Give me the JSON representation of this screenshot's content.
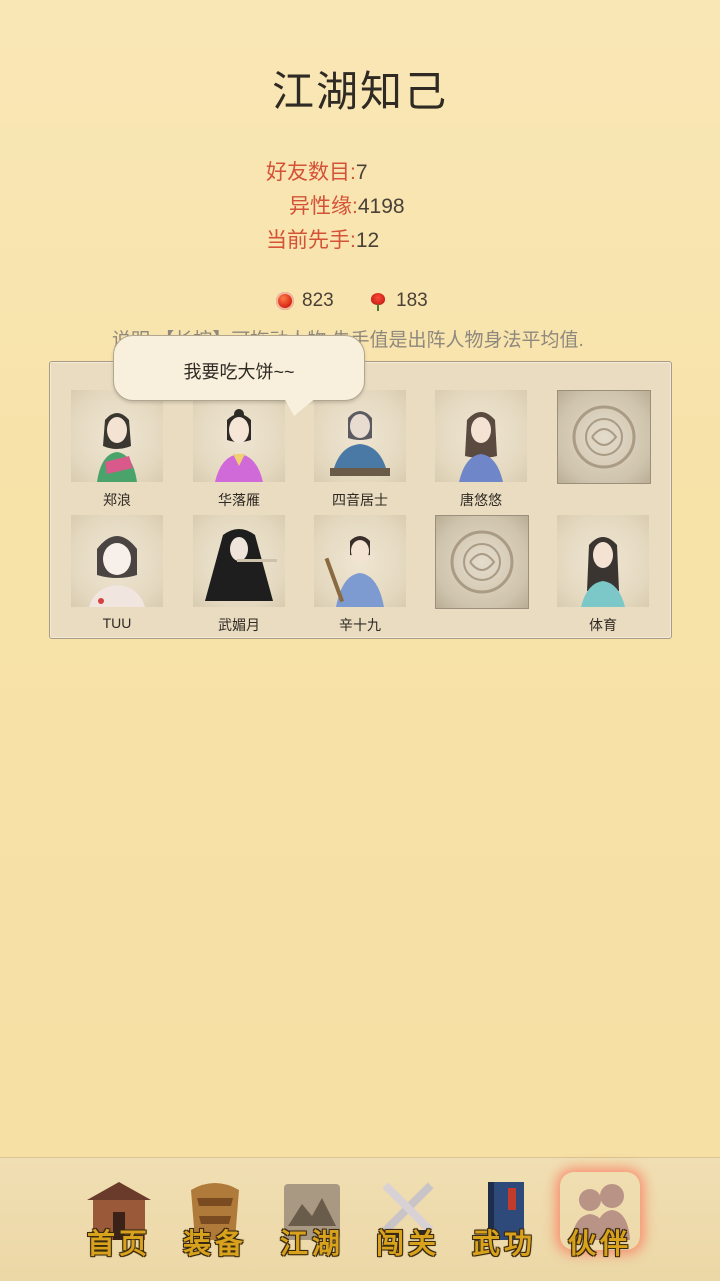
{
  "page": {
    "title": "江湖知己"
  },
  "stats": [
    {
      "label": "好友数目:",
      "value": "7"
    },
    {
      "label": "异性缘:",
      "value": "4198"
    },
    {
      "label": "当前先手:",
      "value": "12"
    }
  ],
  "currency": [
    {
      "icon": "red-gem-icon",
      "value": "823"
    },
    {
      "icon": "rose-icon",
      "value": "183"
    }
  ],
  "description": "说明:【长按】可拖动人物,先手值是出阵人物身法平均值.",
  "bubble": {
    "text": "我要吃大饼~~"
  },
  "partners": [
    {
      "name": "郑浪",
      "color": "#4aa36a"
    },
    {
      "name": "华落雁",
      "color": "#d06ad8"
    },
    {
      "name": "四音居士",
      "color": "#4b79a6"
    },
    {
      "name": "唐悠悠",
      "color": "#6f87c9"
    },
    {
      "name": "",
      "color": ""
    },
    {
      "name": "TUU",
      "color": "#d8c8c0"
    },
    {
      "name": "武媚月",
      "color": "#222222"
    },
    {
      "name": "辛十九",
      "color": "#7d9bd1"
    },
    {
      "name": "",
      "color": ""
    },
    {
      "name": "体育",
      "color": "#7cc8c8"
    }
  ],
  "nav": [
    {
      "label": "首页",
      "icon": "house-icon"
    },
    {
      "label": "装备",
      "icon": "armor-icon"
    },
    {
      "label": "江湖",
      "icon": "scroll-map-icon"
    },
    {
      "label": "闯关",
      "icon": "crossed-swords-icon"
    },
    {
      "label": "武功",
      "icon": "book-icon"
    },
    {
      "label": "伙伴",
      "icon": "partners-icon",
      "active": true
    }
  ]
}
